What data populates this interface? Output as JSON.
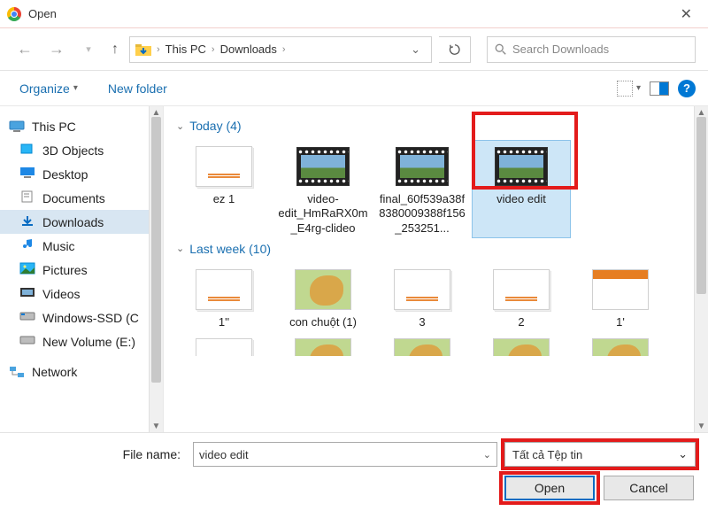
{
  "title": "Open",
  "nav": {
    "path_root": "This PC",
    "path_current": "Downloads",
    "search_placeholder": "Search Downloads"
  },
  "toolbar": {
    "organize": "Organize",
    "new_folder": "New folder"
  },
  "tree": {
    "root": "This PC",
    "items": [
      {
        "icon": "3d",
        "label": "3D Objects"
      },
      {
        "icon": "desktop",
        "label": "Desktop"
      },
      {
        "icon": "doc",
        "label": "Documents"
      },
      {
        "icon": "dl",
        "label": "Downloads",
        "selected": true
      },
      {
        "icon": "music",
        "label": "Music"
      },
      {
        "icon": "pic",
        "label": "Pictures"
      },
      {
        "icon": "video",
        "label": "Videos"
      },
      {
        "icon": "ssd",
        "label": "Windows-SSD (C"
      },
      {
        "icon": "hdd",
        "label": "New Volume (E:)"
      }
    ],
    "network": "Network"
  },
  "groups": [
    {
      "label": "Today (4)",
      "items": [
        {
          "thumb": "doc",
          "label": "ez 1"
        },
        {
          "thumb": "video",
          "label": "video-edit_HmRaRX0m_E4rg-clideo"
        },
        {
          "thumb": "video",
          "label": "final_60f539a38f8380009388f156_253251..."
        },
        {
          "thumb": "video",
          "label": "video edit",
          "selected": true
        }
      ]
    },
    {
      "label": "Last week (10)",
      "items": [
        {
          "thumb": "doc",
          "label": "1''"
        },
        {
          "thumb": "img-green",
          "label": "con chuột (1)"
        },
        {
          "thumb": "doc",
          "label": "3"
        },
        {
          "thumb": "doc",
          "label": "2"
        },
        {
          "thumb": "cal",
          "label": "1'"
        }
      ]
    }
  ],
  "partial_row": [
    {
      "thumb": "doc"
    },
    {
      "thumb": "img-green"
    },
    {
      "thumb": "img-green"
    },
    {
      "thumb": "img-green"
    },
    {
      "thumb": "img-green"
    }
  ],
  "footer": {
    "file_name_label": "File name:",
    "file_name_value": "video edit",
    "filter_label": "Tất cả Tệp tin",
    "open": "Open",
    "cancel": "Cancel"
  }
}
